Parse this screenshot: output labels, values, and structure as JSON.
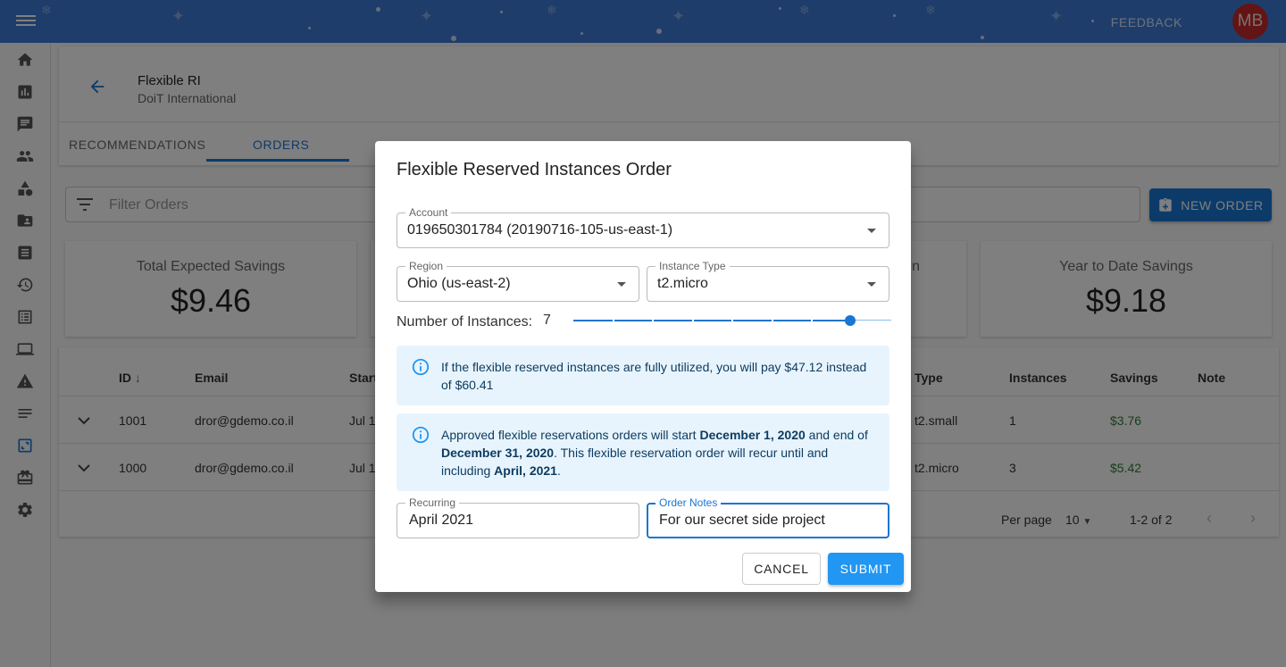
{
  "topbar": {
    "feedback": "FEEDBACK",
    "avatar_initials": "MB",
    "color": "#3f7ad6"
  },
  "sidebar": {
    "icons": [
      "home-icon",
      "chart-icon",
      "chat-icon",
      "people-icon",
      "shapes-icon",
      "folder-account-icon",
      "receipt-icon",
      "history-icon",
      "list-icon",
      "laptop-icon",
      "warning-icon",
      "notes-icon",
      "flexible-ri-icon",
      "gift-icon",
      "settings-icon"
    ]
  },
  "header": {
    "title": "Flexible RI",
    "subtitle": "DoiT International"
  },
  "tabs": [
    {
      "label": "RECOMMENDATIONS"
    },
    {
      "label": "ORDERS",
      "active": true
    }
  ],
  "filter": {
    "placeholder": "Filter Orders"
  },
  "new_order_label": "NEW ORDER",
  "stats": [
    {
      "label": "Total Expected Savings",
      "value": "$9.46"
    },
    {
      "label": "",
      "value": ""
    },
    {
      "label": "n",
      "value": ""
    },
    {
      "label": "Year to Date Savings",
      "value": "$9.18"
    }
  ],
  "table": {
    "headers": {
      "id": "ID",
      "email": "Email",
      "start": "Start",
      "type": "Type",
      "instances": "Instances",
      "savings": "Savings",
      "note": "Note"
    },
    "rows": [
      {
        "id": "1001",
        "email": "dror@gdemo.co.il",
        "start": "Jul 1",
        "type": "t2.small",
        "instances": "1",
        "savings": "$3.76"
      },
      {
        "id": "1000",
        "email": "dror@gdemo.co.il",
        "start": "Jul 1",
        "type": "t2.micro",
        "instances": "3",
        "savings": "$5.42"
      }
    ],
    "per_page_label": "Per page",
    "per_page_value": "10",
    "range": "1-2 of 2"
  },
  "dialog": {
    "title": "Flexible Reserved Instances Order",
    "account": {
      "label": "Account",
      "value": "019650301784 (20190716-105-us-east-1)"
    },
    "region": {
      "label": "Region",
      "value": "Ohio (us-east-2)"
    },
    "instance_type": {
      "label": "Instance Type",
      "value": "t2.micro"
    },
    "instances": {
      "label": "Number of Instances:",
      "value": "7",
      "slider_fraction": 0.875
    },
    "info1": {
      "text": "If the flexible reserved instances are fully utilized, you will pay $47.12 instead of $60.41"
    },
    "info2": {
      "p1": "Approved flexible reservations orders will start ",
      "start": "December 1, 2020",
      "p2": " and end of ",
      "end": "December 31, 2020",
      "p3": ". This flexible reservation order will recur until and including ",
      "until": "April, 2021",
      "p4": "."
    },
    "recurring": {
      "label": "Recurring",
      "value": "April 2021"
    },
    "notes": {
      "label": "Order Notes",
      "value": "For our secret side project"
    },
    "cancel_label": "CANCEL",
    "submit_label": "SUBMIT"
  }
}
